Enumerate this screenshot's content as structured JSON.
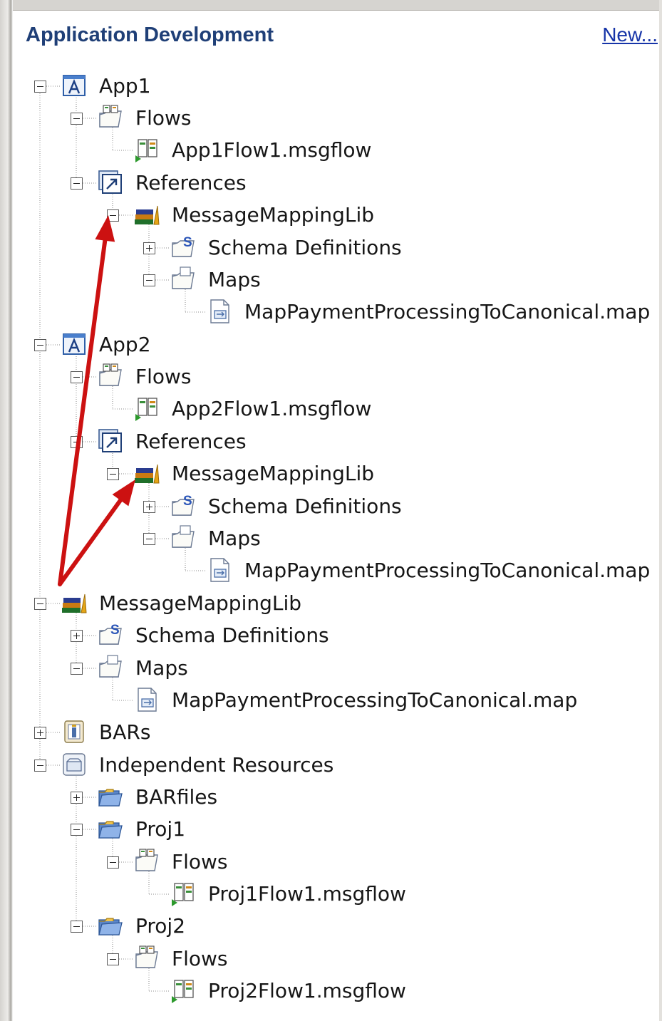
{
  "panel": {
    "title": "Application Development",
    "new_link": "New..."
  },
  "tree": [
    {
      "label": "App1",
      "icon": "application-icon",
      "toggle": "minus"
    },
    {
      "label": "Flows",
      "icon": "flows-folder-icon",
      "toggle": "minus"
    },
    {
      "label": "App1Flow1.msgflow",
      "icon": "msgflow-icon"
    },
    {
      "label": "References",
      "icon": "references-icon",
      "toggle": "minus"
    },
    {
      "label": "MessageMappingLib",
      "icon": "library-icon",
      "toggle": "minus"
    },
    {
      "label": "Schema Definitions",
      "icon": "schema-folder-icon",
      "toggle": "plus"
    },
    {
      "label": "Maps",
      "icon": "maps-folder-icon",
      "toggle": "minus"
    },
    {
      "label": "MapPaymentProcessingToCanonical.map",
      "icon": "map-file-icon"
    },
    {
      "label": "App2",
      "icon": "application-icon",
      "toggle": "minus"
    },
    {
      "label": "Flows",
      "icon": "flows-folder-icon",
      "toggle": "minus"
    },
    {
      "label": "App2Flow1.msgflow",
      "icon": "msgflow-icon"
    },
    {
      "label": "References",
      "icon": "references-icon",
      "toggle": "minus"
    },
    {
      "label": "MessageMappingLib",
      "icon": "library-icon",
      "toggle": "minus"
    },
    {
      "label": "Schema Definitions",
      "icon": "schema-folder-icon",
      "toggle": "plus"
    },
    {
      "label": "Maps",
      "icon": "maps-folder-icon",
      "toggle": "minus"
    },
    {
      "label": "MapPaymentProcessingToCanonical.map",
      "icon": "map-file-icon"
    },
    {
      "label": "MessageMappingLib",
      "icon": "library-icon",
      "toggle": "minus"
    },
    {
      "label": "Schema Definitions",
      "icon": "schema-folder-icon",
      "toggle": "plus"
    },
    {
      "label": "Maps",
      "icon": "maps-folder-icon",
      "toggle": "minus"
    },
    {
      "label": "MapPaymentProcessingToCanonical.map",
      "icon": "map-file-icon"
    },
    {
      "label": "BARs",
      "icon": "bars-icon",
      "toggle": "plus"
    },
    {
      "label": "Independent Resources",
      "icon": "independent-resources-icon",
      "toggle": "minus"
    },
    {
      "label": "BARfiles",
      "icon": "project-folder-icon",
      "toggle": "plus"
    },
    {
      "label": "Proj1",
      "icon": "project-folder-icon",
      "toggle": "minus"
    },
    {
      "label": "Flows",
      "icon": "flows-folder-icon",
      "toggle": "minus"
    },
    {
      "label": "Proj1Flow1.msgflow",
      "icon": "msgflow-icon"
    },
    {
      "label": "Proj2",
      "icon": "project-folder-icon",
      "toggle": "minus"
    },
    {
      "label": "Flows",
      "icon": "flows-folder-icon",
      "toggle": "minus"
    },
    {
      "label": "Proj2Flow1.msgflow",
      "icon": "msgflow-icon"
    }
  ],
  "colors": {
    "title": "#1f3f77",
    "link": "#1634a8",
    "arrow": "#cc1111"
  }
}
